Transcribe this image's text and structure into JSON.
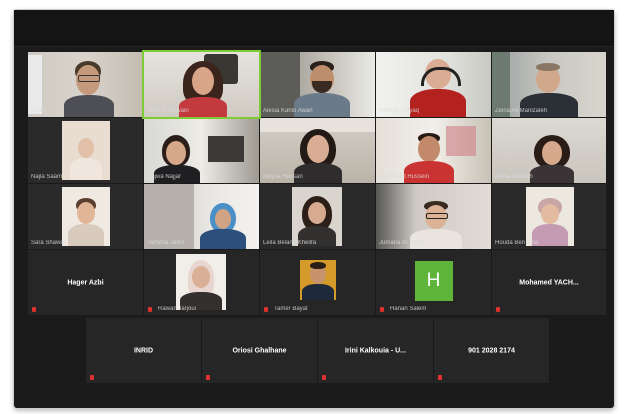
{
  "window": {
    "title": ""
  },
  "colors": {
    "active_speaker": "#7ecb35",
    "muted_mic": "#e0322f",
    "avatar_h": "#5fb43a"
  },
  "rows": [
    {
      "tiles": [
        {
          "type": "video",
          "label": "Lu Je...",
          "active": false
        },
        {
          "type": "video",
          "label": "Iman Al Nuwairi",
          "active": true
        },
        {
          "type": "video",
          "label": "Alesia Kahlo Awan",
          "active": false
        },
        {
          "type": "video",
          "label": "Mervan Solyaq",
          "active": false
        },
        {
          "type": "video",
          "label": "Zeina Ali Manizaleh",
          "active": false
        }
      ]
    },
    {
      "tiles": [
        {
          "type": "video",
          "label": "Najla Saam",
          "active": false
        },
        {
          "type": "video",
          "label": "Najwa Najjar",
          "active": false
        },
        {
          "type": "video",
          "label": "Maysa Hassan",
          "active": false
        },
        {
          "type": "video",
          "label": "Mahmoud Hussein",
          "active": false
        },
        {
          "type": "video",
          "label": "Asma Kaddah",
          "active": false
        }
      ]
    },
    {
      "tiles": [
        {
          "type": "video",
          "label": "Sara Shawqi",
          "active": false
        },
        {
          "type": "video",
          "label": "Tarnima Jamil",
          "active": false
        },
        {
          "type": "video",
          "label": "Leila Belarbi Khelifa",
          "active": false
        },
        {
          "type": "video",
          "label": "Jumana Al Tamimi",
          "active": false
        },
        {
          "type": "video",
          "label": "Houda Ben Attia",
          "active": false
        }
      ]
    },
    {
      "tiles": [
        {
          "type": "name",
          "name": "Hager Azbi",
          "label": ""
        },
        {
          "type": "photo",
          "label": "Rawan Jarjoui"
        },
        {
          "type": "photo",
          "label": "Tamer Bayat"
        },
        {
          "type": "avatar",
          "letter": "H",
          "label": "Hanan Salem"
        },
        {
          "type": "name",
          "name": "Mohamed  YACH...",
          "label": ""
        }
      ]
    },
    {
      "tiles": [
        {
          "type": "name",
          "name": "INRID",
          "label": ""
        },
        {
          "type": "name",
          "name": "Oriosi Ghalhane",
          "label": ""
        },
        {
          "type": "name",
          "name": "Irini Kalkouia - U...",
          "label": ""
        },
        {
          "type": "name",
          "name": "901 2028 2174",
          "label": ""
        }
      ]
    }
  ]
}
